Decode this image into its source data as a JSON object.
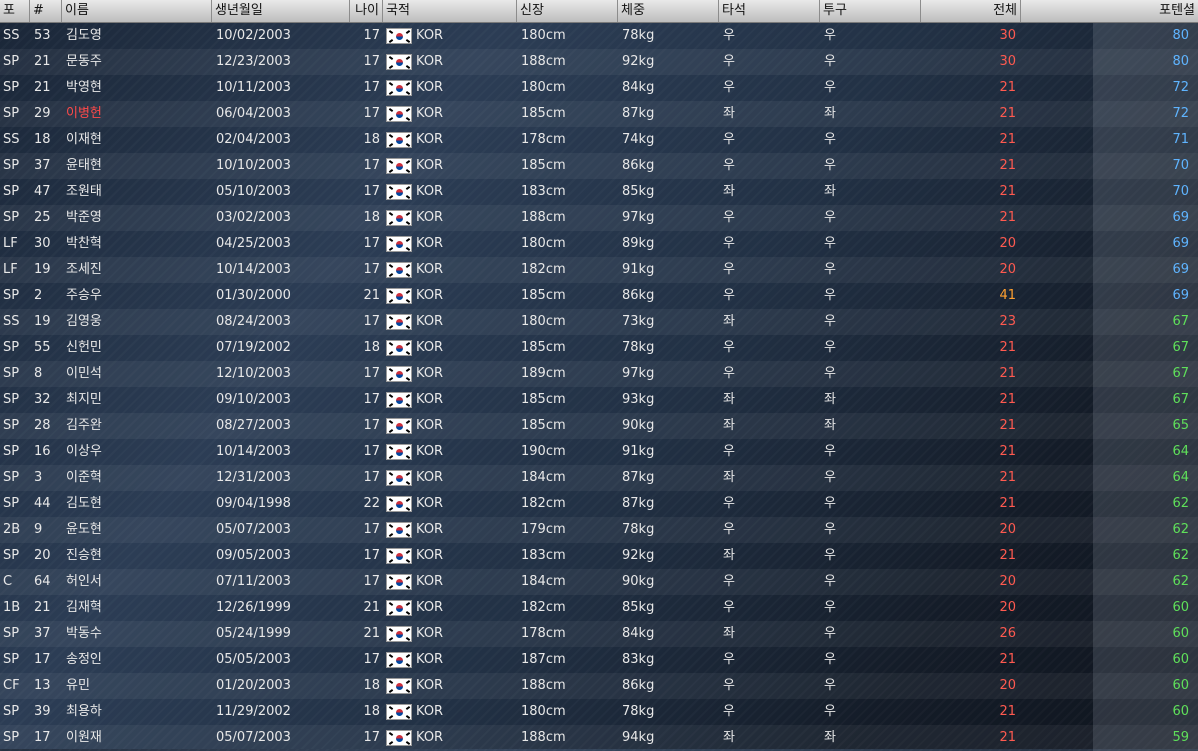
{
  "colors": {
    "ovr_red": "#ff5a50",
    "ovr_orange": "#ffa030",
    "pot_blue": "#5fb4ff",
    "pot_green": "#5fe05a",
    "name_highlight": "#ff4a4a",
    "text": "#e8e8e8"
  },
  "icons": {
    "flag": "korea-flag-icon"
  },
  "columns": [
    {
      "key": "pos",
      "label": "포"
    },
    {
      "key": "num",
      "label": "#"
    },
    {
      "key": "name",
      "label": "이름"
    },
    {
      "key": "dob",
      "label": "생년월일"
    },
    {
      "key": "age",
      "label": "나이"
    },
    {
      "key": "nat",
      "label": "국적"
    },
    {
      "key": "height",
      "label": "신장"
    },
    {
      "key": "weight",
      "label": "체중"
    },
    {
      "key": "bats",
      "label": "타석"
    },
    {
      "key": "throws",
      "label": "투구"
    },
    {
      "key": "ovr",
      "label": "전체"
    },
    {
      "key": "pot",
      "label": "포텐셜"
    }
  ],
  "rows": [
    {
      "pos": "SS",
      "num": "53",
      "name": "김도영",
      "dob": "10/02/2003",
      "age": "17",
      "nat": "KOR",
      "height": "180cm",
      "weight": "78kg",
      "bats": "우",
      "throws": "우",
      "ovr": "30",
      "pot": "80"
    },
    {
      "pos": "SP",
      "num": "21",
      "name": "문동주",
      "dob": "12/23/2003",
      "age": "17",
      "nat": "KOR",
      "height": "188cm",
      "weight": "92kg",
      "bats": "우",
      "throws": "우",
      "ovr": "30",
      "pot": "80"
    },
    {
      "pos": "SP",
      "num": "21",
      "name": "박영현",
      "dob": "10/11/2003",
      "age": "17",
      "nat": "KOR",
      "height": "180cm",
      "weight": "84kg",
      "bats": "우",
      "throws": "우",
      "ovr": "21",
      "pot": "72"
    },
    {
      "pos": "SP",
      "num": "29",
      "name": "이병헌",
      "dob": "06/04/2003",
      "age": "17",
      "nat": "KOR",
      "height": "185cm",
      "weight": "87kg",
      "bats": "좌",
      "throws": "좌",
      "ovr": "21",
      "pot": "72",
      "highlight": true
    },
    {
      "pos": "SS",
      "num": "18",
      "name": "이재현",
      "dob": "02/04/2003",
      "age": "18",
      "nat": "KOR",
      "height": "178cm",
      "weight": "74kg",
      "bats": "우",
      "throws": "우",
      "ovr": "21",
      "pot": "71"
    },
    {
      "pos": "SP",
      "num": "37",
      "name": "윤태현",
      "dob": "10/10/2003",
      "age": "17",
      "nat": "KOR",
      "height": "185cm",
      "weight": "86kg",
      "bats": "우",
      "throws": "우",
      "ovr": "21",
      "pot": "70"
    },
    {
      "pos": "SP",
      "num": "47",
      "name": "조원태",
      "dob": "05/10/2003",
      "age": "17",
      "nat": "KOR",
      "height": "183cm",
      "weight": "85kg",
      "bats": "좌",
      "throws": "좌",
      "ovr": "21",
      "pot": "70"
    },
    {
      "pos": "SP",
      "num": "25",
      "name": "박준영",
      "dob": "03/02/2003",
      "age": "18",
      "nat": "KOR",
      "height": "188cm",
      "weight": "97kg",
      "bats": "우",
      "throws": "우",
      "ovr": "21",
      "pot": "69"
    },
    {
      "pos": "LF",
      "num": "30",
      "name": "박찬혁",
      "dob": "04/25/2003",
      "age": "17",
      "nat": "KOR",
      "height": "180cm",
      "weight": "89kg",
      "bats": "우",
      "throws": "우",
      "ovr": "20",
      "pot": "69"
    },
    {
      "pos": "LF",
      "num": "19",
      "name": "조세진",
      "dob": "10/14/2003",
      "age": "17",
      "nat": "KOR",
      "height": "182cm",
      "weight": "91kg",
      "bats": "우",
      "throws": "우",
      "ovr": "20",
      "pot": "69"
    },
    {
      "pos": "SP",
      "num": "2",
      "name": "주승우",
      "dob": "01/30/2000",
      "age": "21",
      "nat": "KOR",
      "height": "185cm",
      "weight": "86kg",
      "bats": "우",
      "throws": "우",
      "ovr": "41",
      "pot": "69"
    },
    {
      "pos": "SS",
      "num": "19",
      "name": "김영웅",
      "dob": "08/24/2003",
      "age": "17",
      "nat": "KOR",
      "height": "180cm",
      "weight": "73kg",
      "bats": "좌",
      "throws": "우",
      "ovr": "23",
      "pot": "67"
    },
    {
      "pos": "SP",
      "num": "55",
      "name": "신헌민",
      "dob": "07/19/2002",
      "age": "18",
      "nat": "KOR",
      "height": "185cm",
      "weight": "78kg",
      "bats": "우",
      "throws": "우",
      "ovr": "21",
      "pot": "67"
    },
    {
      "pos": "SP",
      "num": "8",
      "name": "이민석",
      "dob": "12/10/2003",
      "age": "17",
      "nat": "KOR",
      "height": "189cm",
      "weight": "97kg",
      "bats": "우",
      "throws": "우",
      "ovr": "21",
      "pot": "67"
    },
    {
      "pos": "SP",
      "num": "32",
      "name": "최지민",
      "dob": "09/10/2003",
      "age": "17",
      "nat": "KOR",
      "height": "185cm",
      "weight": "93kg",
      "bats": "좌",
      "throws": "좌",
      "ovr": "21",
      "pot": "67"
    },
    {
      "pos": "SP",
      "num": "28",
      "name": "김주완",
      "dob": "08/27/2003",
      "age": "17",
      "nat": "KOR",
      "height": "185cm",
      "weight": "90kg",
      "bats": "좌",
      "throws": "좌",
      "ovr": "21",
      "pot": "65"
    },
    {
      "pos": "SP",
      "num": "16",
      "name": "이상우",
      "dob": "10/14/2003",
      "age": "17",
      "nat": "KOR",
      "height": "190cm",
      "weight": "91kg",
      "bats": "우",
      "throws": "우",
      "ovr": "21",
      "pot": "64"
    },
    {
      "pos": "SP",
      "num": "3",
      "name": "이준혁",
      "dob": "12/31/2003",
      "age": "17",
      "nat": "KOR",
      "height": "184cm",
      "weight": "87kg",
      "bats": "좌",
      "throws": "우",
      "ovr": "21",
      "pot": "64"
    },
    {
      "pos": "SP",
      "num": "44",
      "name": "김도현",
      "dob": "09/04/1998",
      "age": "22",
      "nat": "KOR",
      "height": "182cm",
      "weight": "87kg",
      "bats": "우",
      "throws": "우",
      "ovr": "21",
      "pot": "62"
    },
    {
      "pos": "2B",
      "num": "9",
      "name": "윤도현",
      "dob": "05/07/2003",
      "age": "17",
      "nat": "KOR",
      "height": "179cm",
      "weight": "78kg",
      "bats": "우",
      "throws": "우",
      "ovr": "20",
      "pot": "62"
    },
    {
      "pos": "SP",
      "num": "20",
      "name": "진승현",
      "dob": "09/05/2003",
      "age": "17",
      "nat": "KOR",
      "height": "183cm",
      "weight": "92kg",
      "bats": "좌",
      "throws": "우",
      "ovr": "21",
      "pot": "62"
    },
    {
      "pos": "C",
      "num": "64",
      "name": "허인서",
      "dob": "07/11/2003",
      "age": "17",
      "nat": "KOR",
      "height": "184cm",
      "weight": "90kg",
      "bats": "우",
      "throws": "우",
      "ovr": "20",
      "pot": "62"
    },
    {
      "pos": "1B",
      "num": "21",
      "name": "김재혁",
      "dob": "12/26/1999",
      "age": "21",
      "nat": "KOR",
      "height": "182cm",
      "weight": "85kg",
      "bats": "우",
      "throws": "우",
      "ovr": "20",
      "pot": "60"
    },
    {
      "pos": "SP",
      "num": "37",
      "name": "박동수",
      "dob": "05/24/1999",
      "age": "21",
      "nat": "KOR",
      "height": "178cm",
      "weight": "84kg",
      "bats": "좌",
      "throws": "우",
      "ovr": "26",
      "pot": "60"
    },
    {
      "pos": "SP",
      "num": "17",
      "name": "송정인",
      "dob": "05/05/2003",
      "age": "17",
      "nat": "KOR",
      "height": "187cm",
      "weight": "83kg",
      "bats": "우",
      "throws": "우",
      "ovr": "21",
      "pot": "60"
    },
    {
      "pos": "CF",
      "num": "13",
      "name": "유민",
      "dob": "01/20/2003",
      "age": "18",
      "nat": "KOR",
      "height": "188cm",
      "weight": "86kg",
      "bats": "우",
      "throws": "우",
      "ovr": "20",
      "pot": "60"
    },
    {
      "pos": "SP",
      "num": "39",
      "name": "최용하",
      "dob": "11/29/2002",
      "age": "18",
      "nat": "KOR",
      "height": "180cm",
      "weight": "78kg",
      "bats": "우",
      "throws": "우",
      "ovr": "21",
      "pot": "60"
    },
    {
      "pos": "SP",
      "num": "17",
      "name": "이원재",
      "dob": "05/07/2003",
      "age": "17",
      "nat": "KOR",
      "height": "188cm",
      "weight": "94kg",
      "bats": "좌",
      "throws": "좌",
      "ovr": "21",
      "pot": "59"
    }
  ]
}
